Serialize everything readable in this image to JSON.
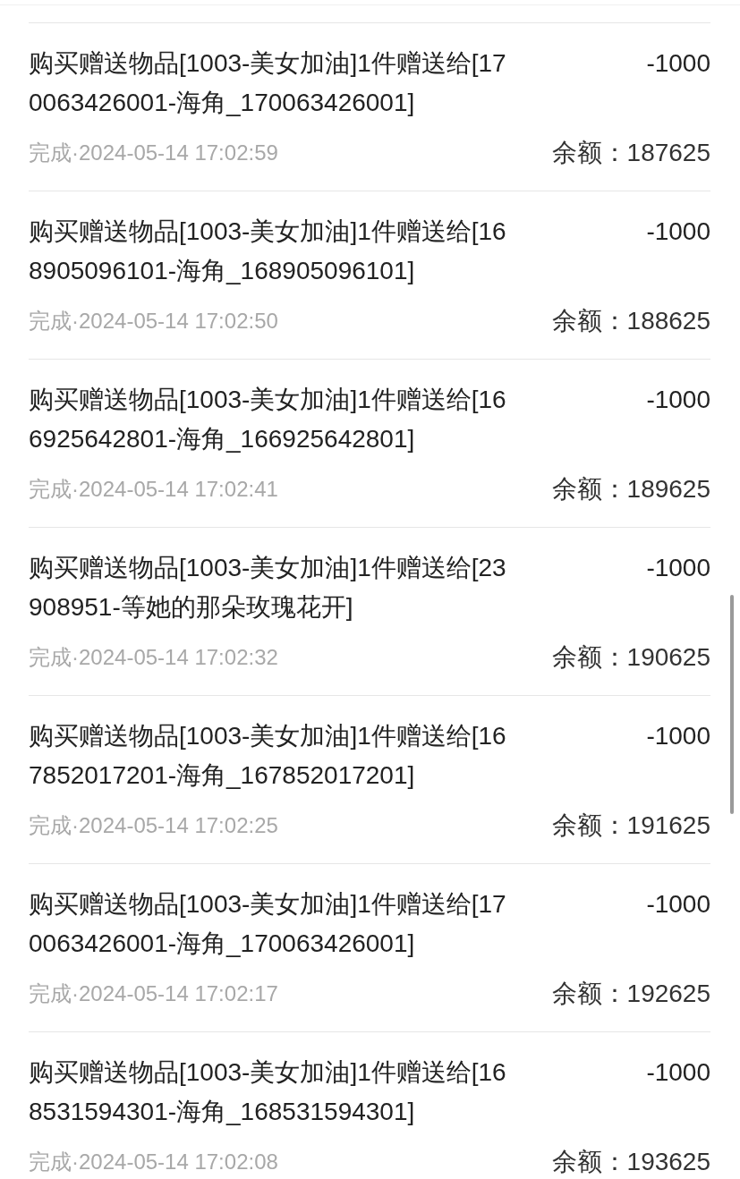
{
  "records": [
    {
      "title": "购买赠送物品[1003-美女加油]1件赠送给[170063426001-海角_170063426001]",
      "amount": "-1000",
      "status": "完成·2024-05-14 17:02:59",
      "balance": "余额：187625"
    },
    {
      "title": "购买赠送物品[1003-美女加油]1件赠送给[168905096101-海角_168905096101]",
      "amount": "-1000",
      "status": "完成·2024-05-14 17:02:50",
      "balance": "余额：188625"
    },
    {
      "title": "购买赠送物品[1003-美女加油]1件赠送给[166925642801-海角_166925642801]",
      "amount": "-1000",
      "status": "完成·2024-05-14 17:02:41",
      "balance": "余额：189625"
    },
    {
      "title": "购买赠送物品[1003-美女加油]1件赠送给[23908951-等她的那朵玫瑰花开]",
      "amount": "-1000",
      "status": "完成·2024-05-14 17:02:32",
      "balance": "余额：190625"
    },
    {
      "title": "购买赠送物品[1003-美女加油]1件赠送给[167852017201-海角_167852017201]",
      "amount": "-1000",
      "status": "完成·2024-05-14 17:02:25",
      "balance": "余额：191625"
    },
    {
      "title": "购买赠送物品[1003-美女加油]1件赠送给[170063426001-海角_170063426001]",
      "amount": "-1000",
      "status": "完成·2024-05-14 17:02:17",
      "balance": "余额：192625"
    },
    {
      "title": "购买赠送物品[1003-美女加油]1件赠送给[168531594301-海角_168531594301]",
      "amount": "-1000",
      "status": "完成·2024-05-14 17:02:08",
      "balance": "余额：193625"
    }
  ]
}
